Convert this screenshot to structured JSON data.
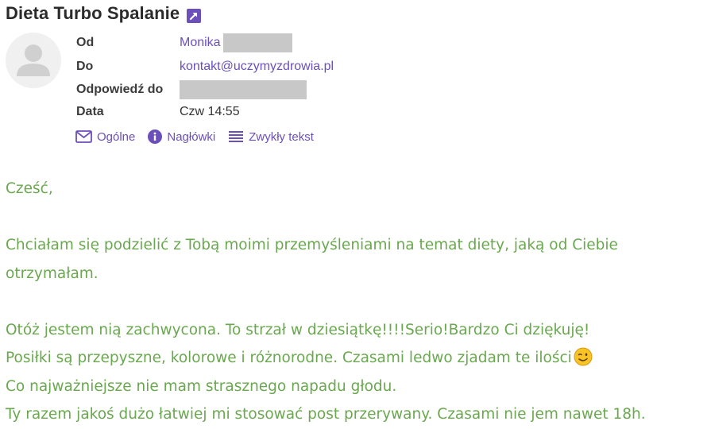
{
  "email": {
    "subject": "Dieta Turbo Spalanie",
    "headers": {
      "from_label": "Od",
      "from_value": "Monika",
      "to_label": "Do",
      "to_value": "kontakt@uczymyzdrowia.pl",
      "reply_label": "Odpowiedź do",
      "date_label": "Data",
      "date_value": "Czw 14:55"
    },
    "views": {
      "general": "Ogólne",
      "headers": "Nagłówki",
      "plain": "Zwykły tekst"
    },
    "body": {
      "greeting": "Cześć,",
      "line1": "Chciałam się podzielić z Tobą moimi przemyśleniami na temat diety, jaką od Ciebie",
      "line2": "otrzymałam.",
      "line3": "Otóż jestem nią zachwycona. To strzał w dziesiątkę!!!!Serio!Bardzo Ci dziękuję!",
      "line4": "Posiłki są przepyszne, kolorowe i różnorodne. Czasami ledwo zjadam te ilości",
      "line5": "Co najważniejsze nie mam strasznego napadu głodu.",
      "line6": "Ty razem jakoś dużo łatwiej mi stosować post przerywany. Czasami nie jem nawet 18h."
    }
  },
  "colors": {
    "accent": "#6b4fbb",
    "body_text": "#6aa84f",
    "redaction": "#c8c8c8"
  },
  "icons": [
    "external-link-icon",
    "avatar-icon",
    "envelope-icon",
    "info-icon",
    "lines-icon",
    "wink-emoji"
  ]
}
